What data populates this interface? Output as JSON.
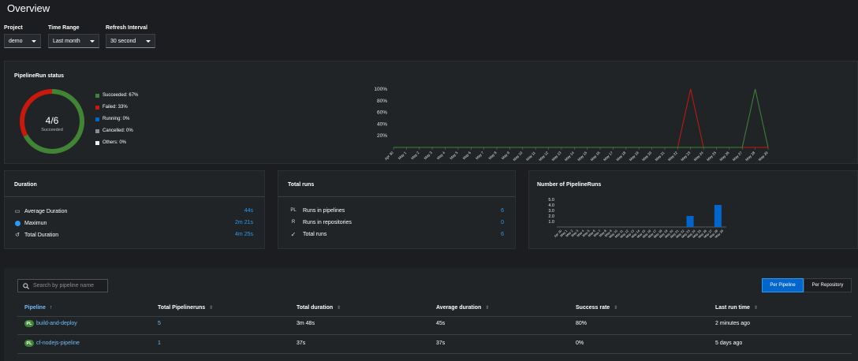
{
  "page": {
    "title": "Overview"
  },
  "filters": {
    "project": {
      "label": "Project",
      "value": "demo"
    },
    "time_range": {
      "label": "Time Range",
      "value": "Last month"
    },
    "refresh": {
      "label": "Refresh Interval",
      "value": "30 second"
    }
  },
  "status_card": {
    "title": "PipelineRun status",
    "donut_value": "4/6",
    "donut_label": "Succeeded",
    "succeeded_fraction": 0.67,
    "legend": [
      {
        "label": "Succeeded: 67%",
        "color": "#3e8635"
      },
      {
        "label": "Failed: 33%",
        "color": "#c9190b"
      },
      {
        "label": "Running: 0%",
        "color": "#0066cc"
      },
      {
        "label": "Cancelled: 0%",
        "color": "#8a8d90"
      },
      {
        "label": "Others: 0%",
        "color": "#f0f0f0"
      }
    ]
  },
  "duration_card": {
    "title": "Duration",
    "rows": [
      {
        "label": "Average Duration",
        "value": "44s",
        "icon": "monitor-icon"
      },
      {
        "label": "Maximun",
        "value": "2m 21s",
        "icon": "info-circle-icon"
      },
      {
        "label": "Total Duration",
        "value": "4m 25s",
        "icon": "history-icon"
      }
    ]
  },
  "runs_card": {
    "title": "Total runs",
    "rows": [
      {
        "icon_text": "PL",
        "label": "Runs in pipelines",
        "value": "6"
      },
      {
        "icon_text": "R",
        "label": "Runs in repositories",
        "value": "0"
      },
      {
        "icon_text": "✓",
        "label": "Total runs",
        "value": "6"
      }
    ]
  },
  "count_card": {
    "title": "Number of PipelineRuns"
  },
  "chart_data": [
    {
      "type": "line",
      "y_ticks": [
        "100%",
        "80%",
        "60%",
        "40%",
        "20%"
      ],
      "ylim": [
        0,
        100
      ],
      "categories": [
        "Apr 30",
        "May 1",
        "May 2",
        "May 3",
        "May 4",
        "May 5",
        "May 6",
        "May 7",
        "May 8",
        "May 9",
        "May 10",
        "May 11",
        "May 12",
        "May 13",
        "May 14",
        "May 15",
        "May 16",
        "May 17",
        "May 18",
        "May 19",
        "May 20",
        "May 21",
        "May 22",
        "May 23",
        "May 24",
        "May 25",
        "May 26",
        "May 27",
        "May 28",
        "May 29"
      ],
      "series": [
        {
          "color": "#c9190b",
          "values": [
            0,
            0,
            0,
            0,
            0,
            0,
            0,
            0,
            0,
            0,
            0,
            0,
            0,
            0,
            0,
            0,
            0,
            0,
            0,
            0,
            0,
            0,
            0,
            100,
            0,
            0,
            0,
            0,
            0,
            0
          ]
        },
        {
          "color": "#3e8635",
          "values": [
            0,
            0,
            0,
            0,
            0,
            0,
            0,
            0,
            0,
            0,
            0,
            0,
            0,
            0,
            0,
            0,
            0,
            0,
            0,
            0,
            0,
            0,
            0,
            0,
            0,
            0,
            0,
            0,
            100,
            0
          ]
        }
      ]
    },
    {
      "type": "bar",
      "y_ticks": [
        "5.0",
        "4.0",
        "3.0",
        "2.0",
        "1.0"
      ],
      "ylim": [
        0,
        5
      ],
      "categories": [
        "Apr 30",
        "May 1",
        "May 2",
        "May 3",
        "May 4",
        "May 5",
        "May 6",
        "May 7",
        "May 8",
        "May 9",
        "May 10",
        "May 11",
        "May 12",
        "May 13",
        "May 14",
        "May 15",
        "May 16",
        "May 17",
        "May 18",
        "May 19",
        "May 20",
        "May 21",
        "May 22",
        "May 23",
        "May 24",
        "May 25",
        "May 26",
        "May 27",
        "May 28",
        "May 29"
      ],
      "values": [
        0,
        0,
        0,
        0,
        0,
        0,
        0,
        0,
        0,
        0,
        0,
        0,
        0,
        0,
        0,
        0,
        0,
        0,
        0,
        0,
        0,
        0,
        0,
        2,
        0,
        0,
        0,
        0,
        4,
        0
      ],
      "color": "#0066cc"
    }
  ],
  "table": {
    "search_placeholder": "Search by pipeline name",
    "toggle": {
      "per_pipeline": "Per Pipeline",
      "per_repository": "Per Repository"
    },
    "columns": [
      "Pipeline",
      "Total Pipelineruns",
      "Total duration",
      "Average duration",
      "Success rate",
      "Last run time"
    ],
    "rows": [
      {
        "badge": "PL",
        "name": "build-and-deploy",
        "runs": "5",
        "total": "3m 48s",
        "avg": "45s",
        "rate": "80%",
        "last": "2 minutes ago"
      },
      {
        "badge": "PL",
        "name": "cf-nodejs-pipeline",
        "runs": "1",
        "total": "37s",
        "avg": "37s",
        "rate": "0%",
        "last": "5 days ago"
      }
    ]
  }
}
